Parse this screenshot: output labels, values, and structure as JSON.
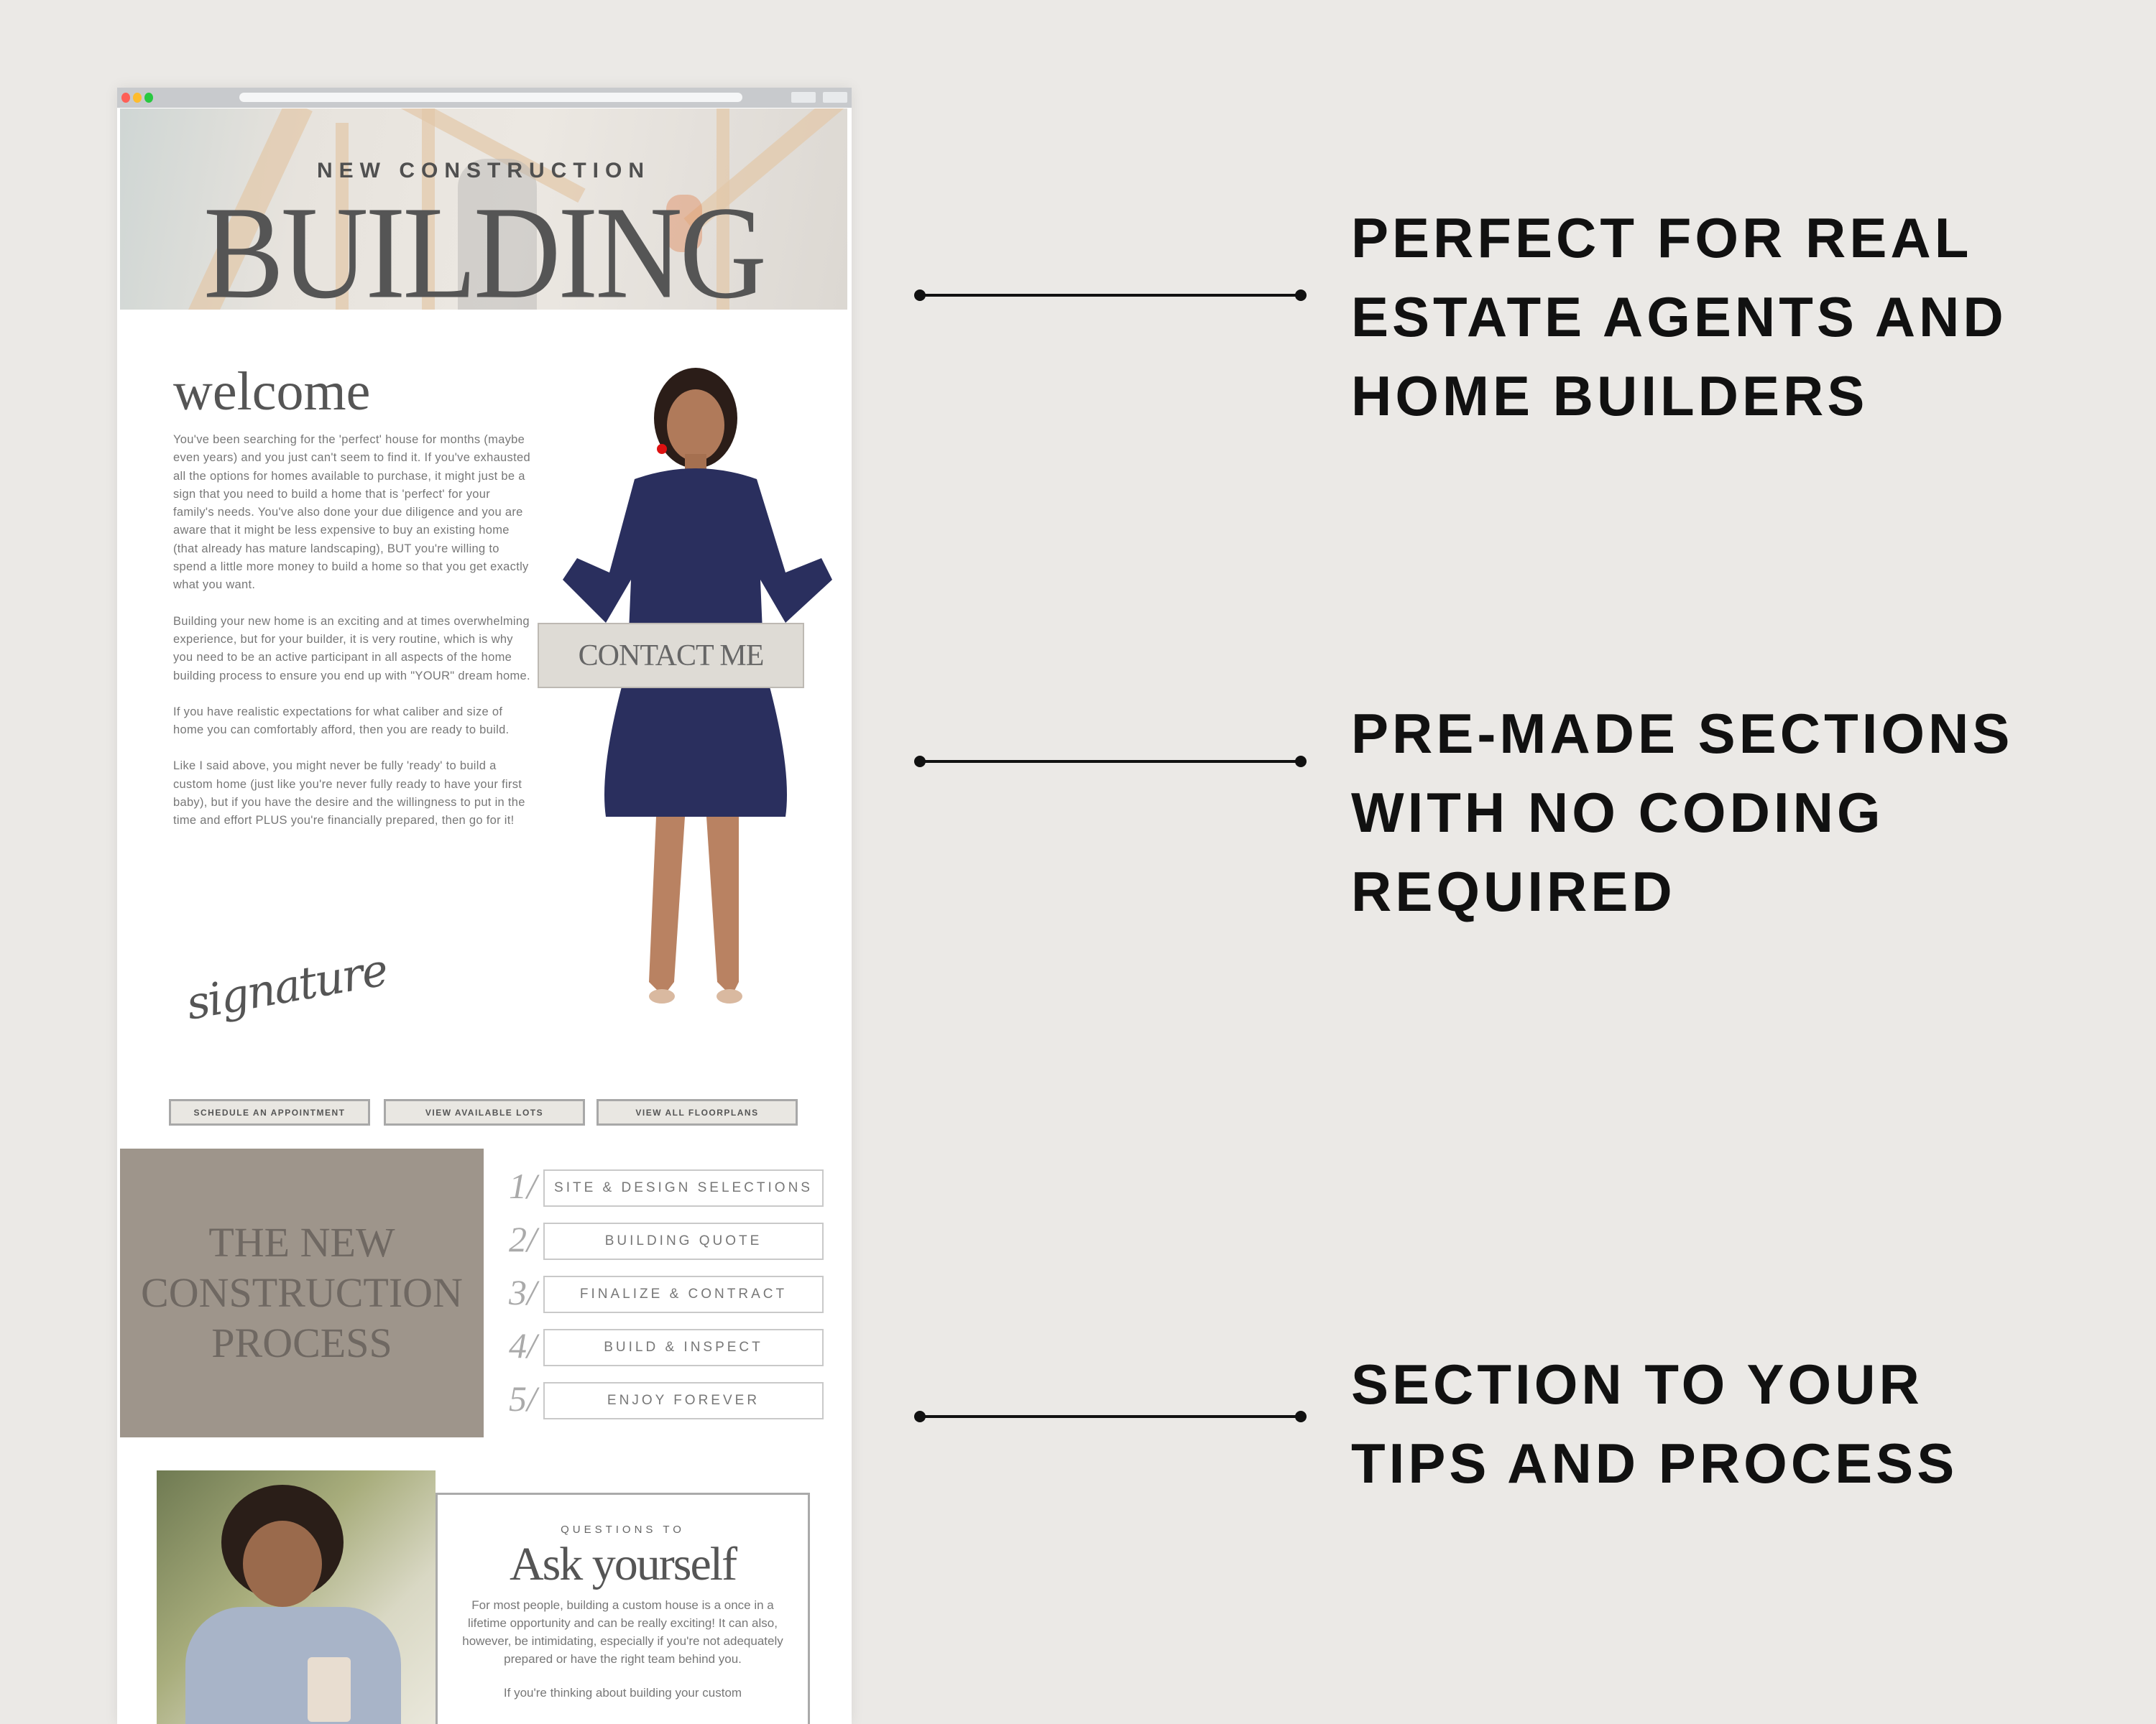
{
  "browser": {
    "traffic_lights": {
      "close": "#ff5f57",
      "minimize": "#febc2e",
      "maximize": "#28c840"
    }
  },
  "hero": {
    "subtitle": "NEW CONSTRUCTION",
    "title": "BUILDING"
  },
  "welcome": {
    "heading": "welcome",
    "paragraphs": [
      "You've been searching for the 'perfect' house for months (maybe even years) and you just can't seem to find it. If you've exhausted all the options for homes available to purchase, it might just be a sign that you need to build a home that is 'perfect' for your family's needs. You've also done your due diligence and you are aware that it might be less expensive to buy an existing home (that already has mature landscaping), BUT you're willing to spend a little more money to build a home so that you get exactly what you want.",
      "Building your new home is an exciting and at times overwhelming experience, but for your builder, it is very routine, which is why you need to be an active participant in all aspects of the home building process to ensure you end up with \"YOUR\" dream home.",
      "If you have realistic expectations for what caliber and size of home you can comfortably afford, then you are ready to build.",
      "Like I said above, you might never be fully 'ready' to build a custom home (just like you're never fully ready to have your first baby), but if you have the desire and the willingness to put in the time and effort PLUS you're financially prepared, then go for it!"
    ],
    "signature": "signature",
    "contact_button": "CONTACT ME"
  },
  "cta_buttons": [
    "SCHEDULE AN APPOINTMENT",
    "VIEW AVAILABLE LOTS",
    "VIEW ALL FLOORPLANS"
  ],
  "process": {
    "title_lines": [
      "THE NEW",
      "CONSTRUCTION",
      "PROCESS"
    ],
    "steps": [
      {
        "num": "1/",
        "label": "SITE & DESIGN SELECTIONS"
      },
      {
        "num": "2/",
        "label": "BUILDING QUOTE"
      },
      {
        "num": "3/",
        "label": "FINALIZE & CONTRACT"
      },
      {
        "num": "4/",
        "label": "BUILD & INSPECT"
      },
      {
        "num": "5/",
        "label": "ENJOY FOREVER"
      }
    ]
  },
  "ask": {
    "pre": "QUESTIONS TO",
    "title": "Ask yourself",
    "body": "For most people, building a custom house is a once in a lifetime opportunity and can be really exciting! It can also, however, be intimidating, especially if you're not adequately prepared or have the right team behind you.",
    "body2": "If you're thinking about building your custom"
  },
  "features": [
    {
      "lines": [
        "PERFECT FOR REAL",
        "ESTATE AGENTS AND",
        "HOME BUILDERS"
      ]
    },
    {
      "lines": [
        "PRE-MADE SECTIONS",
        "WITH NO CODING",
        "REQUIRED"
      ]
    },
    {
      "lines": [
        "SECTION TO YOUR",
        "TIPS AND PROCESS"
      ]
    }
  ],
  "colors": {
    "background": "#ebe9e6",
    "taupe": "#9e958b",
    "dress": "#2a2f5e"
  }
}
